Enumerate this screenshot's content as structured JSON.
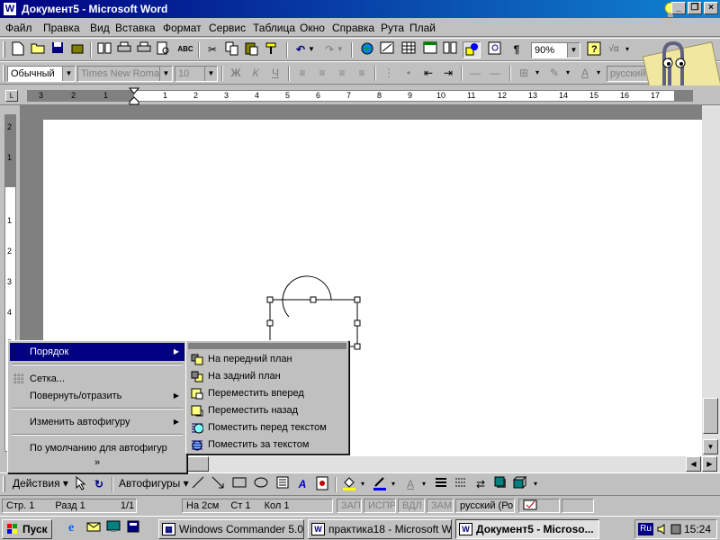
{
  "window": {
    "title": "Документ5 - Microsoft Word",
    "app_icon": "W",
    "controls": [
      "_",
      "❐",
      "×"
    ]
  },
  "menubar": {
    "items": [
      "Файл",
      "Правка",
      "Вид",
      "Вставка",
      "Формат",
      "Сервис",
      "Таблица",
      "Окно",
      "Справка",
      "Рута",
      "Плай"
    ]
  },
  "toolbar_standard": {
    "zoom": "90%"
  },
  "toolbar_formatting": {
    "style": "Обычный",
    "font": "Times New Roman",
    "size": "10",
    "bold": "Ж",
    "italic": "К",
    "underline": "Ч",
    "language": "русский"
  },
  "ruler": {
    "corner": "L",
    "left_numbers": [
      "3",
      "2",
      "1"
    ],
    "right_numbers": [
      "1",
      "2",
      "3",
      "4",
      "5",
      "6",
      "7",
      "8",
      "9",
      "10",
      "11",
      "12",
      "13",
      "14",
      "15",
      "16",
      "17"
    ],
    "vertical_numbers": [
      "2",
      "1",
      "1",
      "2",
      "3",
      "4",
      "5"
    ]
  },
  "popup_menu": {
    "items": [
      {
        "label": "Порядок",
        "has_submenu": true,
        "highlighted": true
      },
      {
        "label": "Сетка...",
        "has_submenu": false
      },
      {
        "label": "Повернуть/отразить",
        "has_submenu": true
      },
      {
        "label": "Изменить автофигуру",
        "has_submenu": true
      },
      {
        "label": "По умолчанию для автофигур",
        "has_submenu": false
      }
    ],
    "expand": "»"
  },
  "submenu": {
    "items": [
      {
        "label": "На передний план",
        "icon": "bring-to-front-icon"
      },
      {
        "label": "На задний план",
        "icon": "send-to-back-icon"
      },
      {
        "label": "Переместить вперед",
        "icon": "bring-forward-icon"
      },
      {
        "label": "Переместить назад",
        "icon": "send-backward-icon"
      },
      {
        "label": "Поместить перед текстом",
        "icon": "bring-in-front-of-text-icon"
      },
      {
        "label": "Поместить за текстом",
        "icon": "send-behind-text-icon"
      }
    ]
  },
  "drawbar": {
    "actions": "Действия",
    "autoshapes": "Автофигуры"
  },
  "statusbar": {
    "page": "Стр.",
    "page_num": "1",
    "section": "Разд",
    "section_num": "1",
    "pages": "1/1",
    "at": "На",
    "at_val": "2см",
    "line": "Ст",
    "line_num": "1",
    "col": "Кол",
    "col_num": "1",
    "rec": "ЗАП",
    "trk": "ИСПР",
    "ext": "ВДЛ",
    "ovr": "ЗАМ",
    "lang": "русский (Ро"
  },
  "taskbar": {
    "start": "Пуск",
    "tasks": [
      {
        "label": "Windows Commander 5.0",
        "active": false
      },
      {
        "label": "практика18 - Microsoft W...",
        "active": false
      },
      {
        "label": "Документ5 - Microso...",
        "active": true
      }
    ],
    "lang": "Ru",
    "clock": "15:24"
  }
}
